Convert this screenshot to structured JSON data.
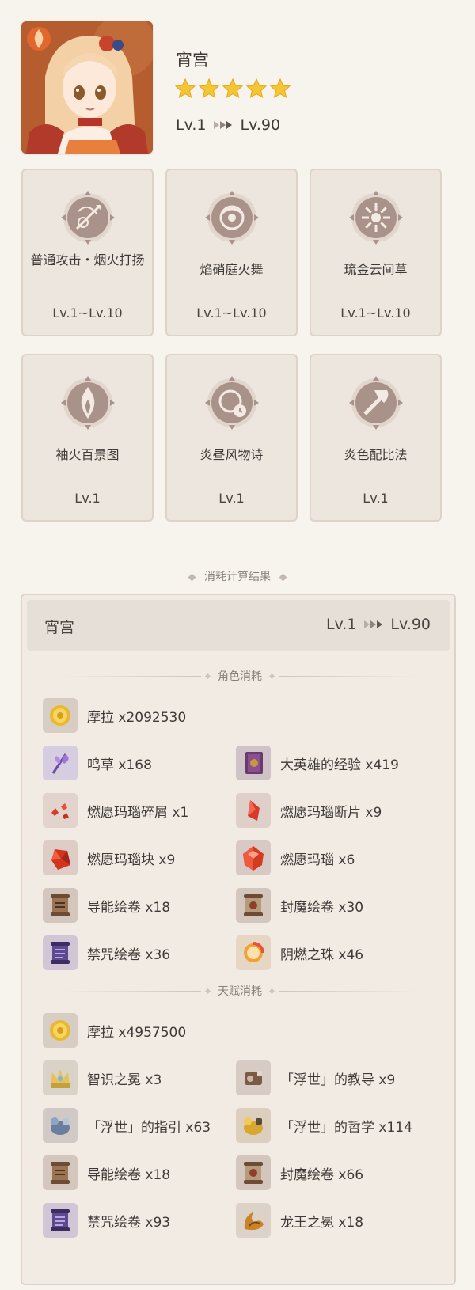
{
  "character": {
    "name": "宵宫",
    "rarity": 5,
    "level_from": "Lv.1",
    "level_to": "Lv.90"
  },
  "skills": [
    {
      "name": "普通攻击・烟火打扬",
      "level": "Lv.1~Lv.10",
      "icon": "bow-attack-icon"
    },
    {
      "name": "焰硝庭火舞",
      "level": "Lv.1~Lv.10",
      "icon": "elemental-skill-icon"
    },
    {
      "name": "琉金云间草",
      "level": "Lv.1~Lv.10",
      "icon": "elemental-burst-icon"
    },
    {
      "name": "袖火百景图",
      "level": "Lv.1",
      "icon": "flame-passive-icon"
    },
    {
      "name": "炎昼风物诗",
      "level": "Lv.1",
      "icon": "timer-passive-icon"
    },
    {
      "name": "炎色配比法",
      "level": "Lv.1",
      "icon": "hammer-passive-icon"
    }
  ],
  "result": {
    "title": "消耗计算结果",
    "char_name": "宵宫",
    "level_from": "Lv.1",
    "level_to": "Lv.90",
    "char_section": "角色消耗",
    "talent_section": "天赋消耗",
    "char_materials": [
      {
        "text": "摩拉 x2092530",
        "icon": "mora-icon"
      },
      {
        "text": "鸣草 x168",
        "icon": "naku-weed-icon"
      },
      {
        "text": "大英雄的经验 x419",
        "icon": "hero-wit-icon"
      },
      {
        "text": "燃愿玛瑙碎屑 x1",
        "icon": "agnidus-sliver-icon"
      },
      {
        "text": "燃愿玛瑙断片 x9",
        "icon": "agnidus-fragment-icon"
      },
      {
        "text": "燃愿玛瑙块 x9",
        "icon": "agnidus-chunk-icon"
      },
      {
        "text": "燃愿玛瑙 x6",
        "icon": "agnidus-gemstone-icon"
      },
      {
        "text": "导能绘卷 x18",
        "icon": "divining-scroll-icon"
      },
      {
        "text": "封魔绘卷 x30",
        "icon": "sealed-scroll-icon"
      },
      {
        "text": "禁咒绘卷 x36",
        "icon": "forbidden-scroll-icon"
      },
      {
        "text": "阴燃之珠 x46",
        "icon": "smoldering-pearl-icon"
      }
    ],
    "talent_materials": [
      {
        "text": "摩拉 x4957500",
        "icon": "mora-icon"
      },
      {
        "text": "智识之冕 x3",
        "icon": "crown-icon"
      },
      {
        "text": "「浮世」的教导 x9",
        "icon": "transience-teachings-icon"
      },
      {
        "text": "「浮世」的指引 x63",
        "icon": "transience-guide-icon"
      },
      {
        "text": "「浮世」的哲学 x114",
        "icon": "transience-philosophies-icon"
      },
      {
        "text": "导能绘卷 x18",
        "icon": "divining-scroll-icon"
      },
      {
        "text": "封魔绘卷 x66",
        "icon": "sealed-scroll-icon"
      },
      {
        "text": "禁咒绘卷 x93",
        "icon": "forbidden-scroll-icon"
      },
      {
        "text": "龙王之冕 x18",
        "icon": "dragon-lord-crown-icon"
      }
    ]
  },
  "colors": {
    "background": "#f7f3ed",
    "card": "#ece6df",
    "star": "#f5c533",
    "icon_circle": "#a8928a"
  }
}
